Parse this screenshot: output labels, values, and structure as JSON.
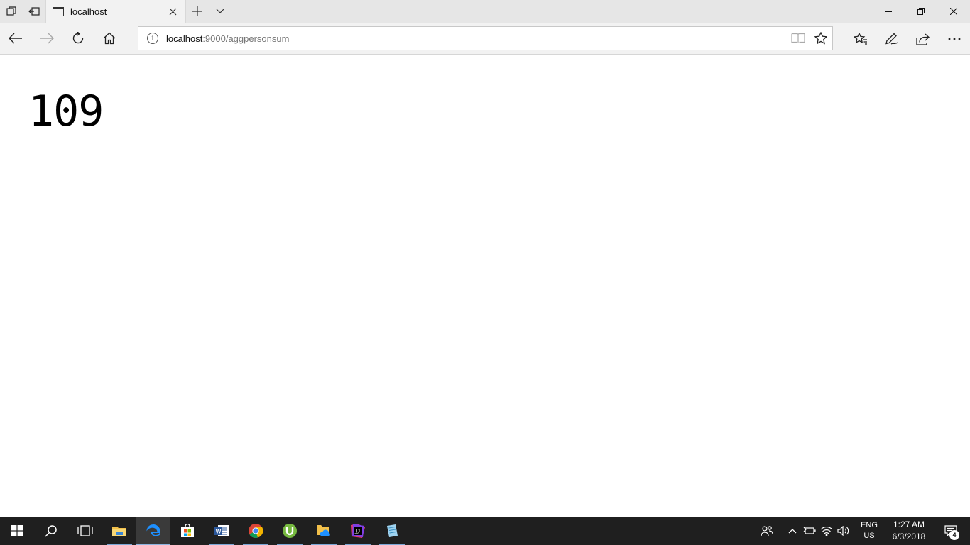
{
  "tab": {
    "title": "localhost"
  },
  "address": {
    "host": "localhost",
    "rest": ":9000/aggpersonsum"
  },
  "page": {
    "result": "109"
  },
  "taskbar": {
    "apps": [
      "start",
      "search",
      "task-view",
      "file-explorer",
      "edge",
      "store",
      "word",
      "chrome",
      "utorrent",
      "onedrive-files",
      "intellij",
      "notepad"
    ],
    "language": {
      "line1": "ENG",
      "line2": "US"
    },
    "clock": {
      "time": "1:27 AM",
      "date": "6/3/2018"
    },
    "notification_count": "4"
  },
  "colors": {
    "accent": "#0078d7",
    "taskbar": "#1f1f1f",
    "chrome": "#f2f2f2"
  }
}
